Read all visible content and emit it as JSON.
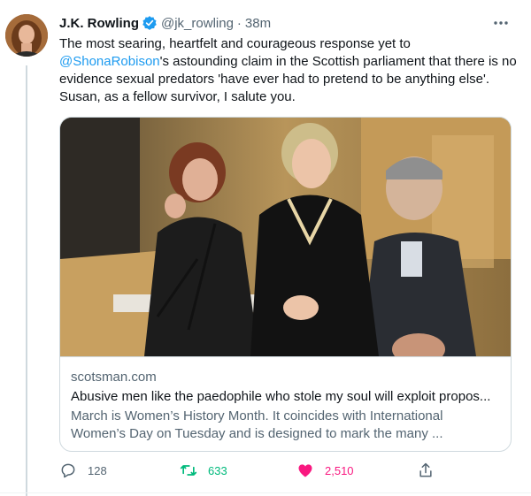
{
  "author": {
    "name": "J.K. Rowling",
    "handle": "@jk_rowling",
    "separator": "·",
    "time": "38m"
  },
  "tweet": {
    "text_before": "The most searing, heartfelt and courageous response yet to ",
    "mention": "@ShonaRobison",
    "text_after": "'s astounding claim in the Scottish parliament that there is no evidence sexual predators 'have ever had to pretend to be anything else'. Susan, as a fellow survivor, I salute you."
  },
  "card": {
    "domain": "scotsman.com",
    "title": "Abusive men like the paedophile who stole my soul will exploit propos...",
    "description": "March is Women’s History Month. It coincides with International Women’s Day on Tuesday and is designed to mark the many ..."
  },
  "actions": {
    "reply_count": "128",
    "retweet_count": "633",
    "like_count": "2,510"
  },
  "icons": {
    "verified": "verified-badge-icon",
    "more": "more-icon",
    "reply": "reply-icon",
    "retweet": "retweet-icon",
    "like": "heart-icon",
    "share": "share-icon"
  },
  "colors": {
    "link": "#1d9bf0",
    "retweet": "#00ba7c",
    "like": "#f91880",
    "muted": "#536471"
  }
}
